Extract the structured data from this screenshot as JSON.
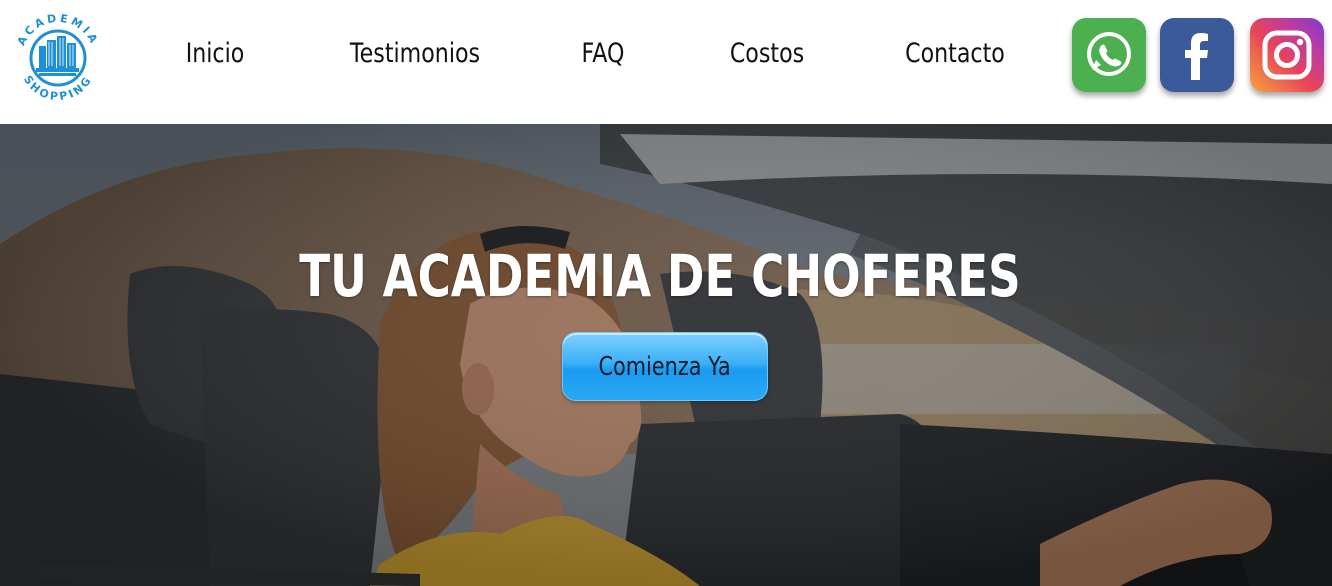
{
  "brand": {
    "logo_top_text": "ACADEMIA",
    "logo_bottom_text": "SHOPPING",
    "logo_color": "#1e90d6"
  },
  "nav": {
    "items": [
      {
        "label": "Inicio"
      },
      {
        "label": "Testimonios"
      },
      {
        "label": "FAQ"
      },
      {
        "label": "Costos"
      },
      {
        "label": "Contacto"
      }
    ]
  },
  "social": {
    "icons": [
      "whatsapp-icon",
      "facebook-icon",
      "instagram-icon"
    ]
  },
  "hero": {
    "title": "TU ACADEMIA DE CHOFERES",
    "cta_label": "Comienza Ya",
    "cta_color": "#2aa8f5"
  }
}
